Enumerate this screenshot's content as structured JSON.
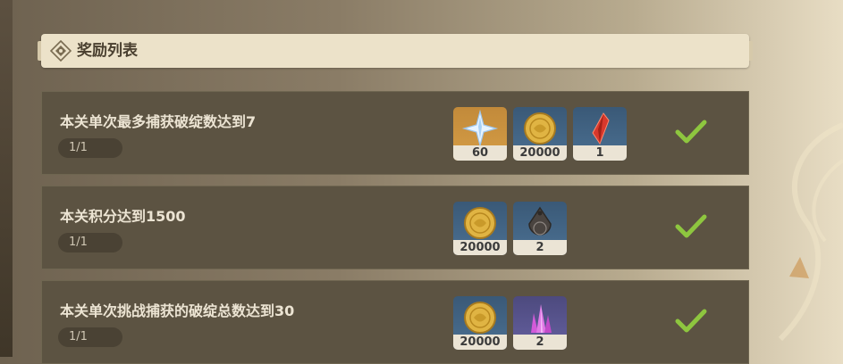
{
  "header": {
    "title": "奖励列表",
    "icon": "diamond-emblem-icon"
  },
  "rewards": [
    {
      "description": "本关单次最多捕获破绽数达到7",
      "progress": "1/1",
      "completed": true,
      "items": [
        {
          "icon": "primogem-icon",
          "count": "60"
        },
        {
          "icon": "mora-coin-icon",
          "count": "20000"
        },
        {
          "icon": "red-crystal-icon",
          "count": "1"
        }
      ]
    },
    {
      "description": "本关积分达到1500",
      "progress": "1/1",
      "completed": true,
      "items": [
        {
          "icon": "mora-coin-icon",
          "count": "20000"
        },
        {
          "icon": "talisman-icon",
          "count": "2"
        }
      ]
    },
    {
      "description": "本关单次挑战捕获的破绽总数达到30",
      "progress": "1/1",
      "completed": true,
      "items": [
        {
          "icon": "mora-coin-icon",
          "count": "20000"
        },
        {
          "icon": "crystal-cluster-icon",
          "count": "2"
        }
      ]
    }
  ],
  "colors": {
    "check": "#8ec63f",
    "row_bg": "#5c5342",
    "header_bg": "#ece2c9"
  }
}
